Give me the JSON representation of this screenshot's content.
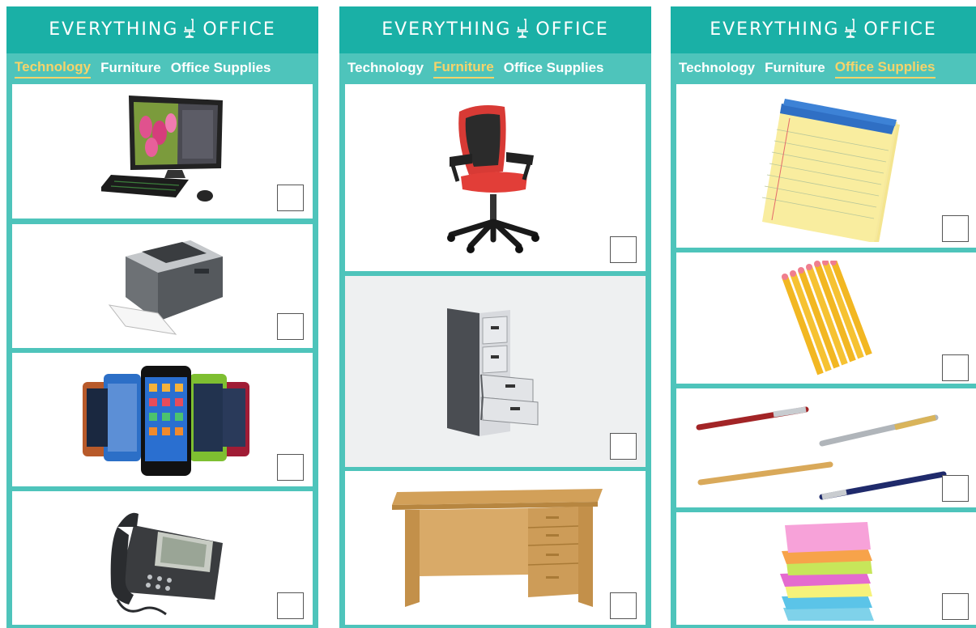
{
  "brand": {
    "left": "EVERYTHING",
    "right": "OFFICE",
    "icon": "office-chair-icon"
  },
  "tabs": [
    "Technology",
    "Furniture",
    "Office Supplies"
  ],
  "panels": [
    {
      "active_tab": "Technology",
      "products": [
        "desktop-computer",
        "laser-printer",
        "smartphones",
        "desk-phone"
      ]
    },
    {
      "active_tab": "Furniture",
      "products": [
        "office-chair",
        "filing-cabinet",
        "desk"
      ]
    },
    {
      "active_tab": "Office Supplies",
      "products": [
        "legal-pad",
        "pencils",
        "pens",
        "sticky-notes"
      ]
    }
  ],
  "colors": {
    "panel": "#4ec4bb",
    "header": "#1ab0a6",
    "active_tab": "#f6d36a"
  }
}
